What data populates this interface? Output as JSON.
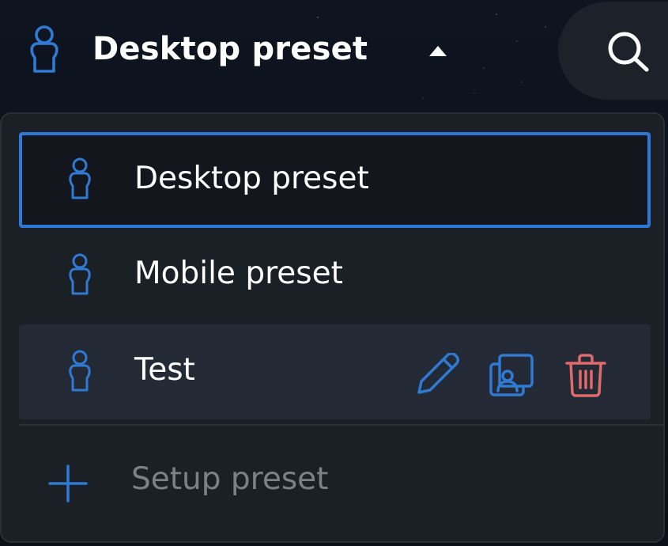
{
  "header": {
    "title": "Desktop preset",
    "icons": {
      "person": "person-icon",
      "caret": "caret-up-icon",
      "search": "search-icon"
    }
  },
  "dropdown": {
    "options": [
      {
        "label": "Desktop preset",
        "state": "selected",
        "icon": "person-icon"
      },
      {
        "label": "Mobile preset",
        "state": "default",
        "icon": "person-icon"
      },
      {
        "label": "Test",
        "state": "hovered",
        "icon": "person-icon",
        "actions": [
          "edit-icon",
          "duplicate-icon",
          "delete-icon"
        ]
      }
    ],
    "setup": {
      "label": "Setup preset",
      "icon": "plus-icon"
    }
  },
  "colors": {
    "accent": "#2d79d8",
    "icon_blue": "#2f7ad3",
    "delete_red": "#e06a6a",
    "panel_bg": "#1b1f26",
    "hover_bg": "#232a36",
    "text": "#ffffff",
    "muted_text": "#7c8088"
  }
}
